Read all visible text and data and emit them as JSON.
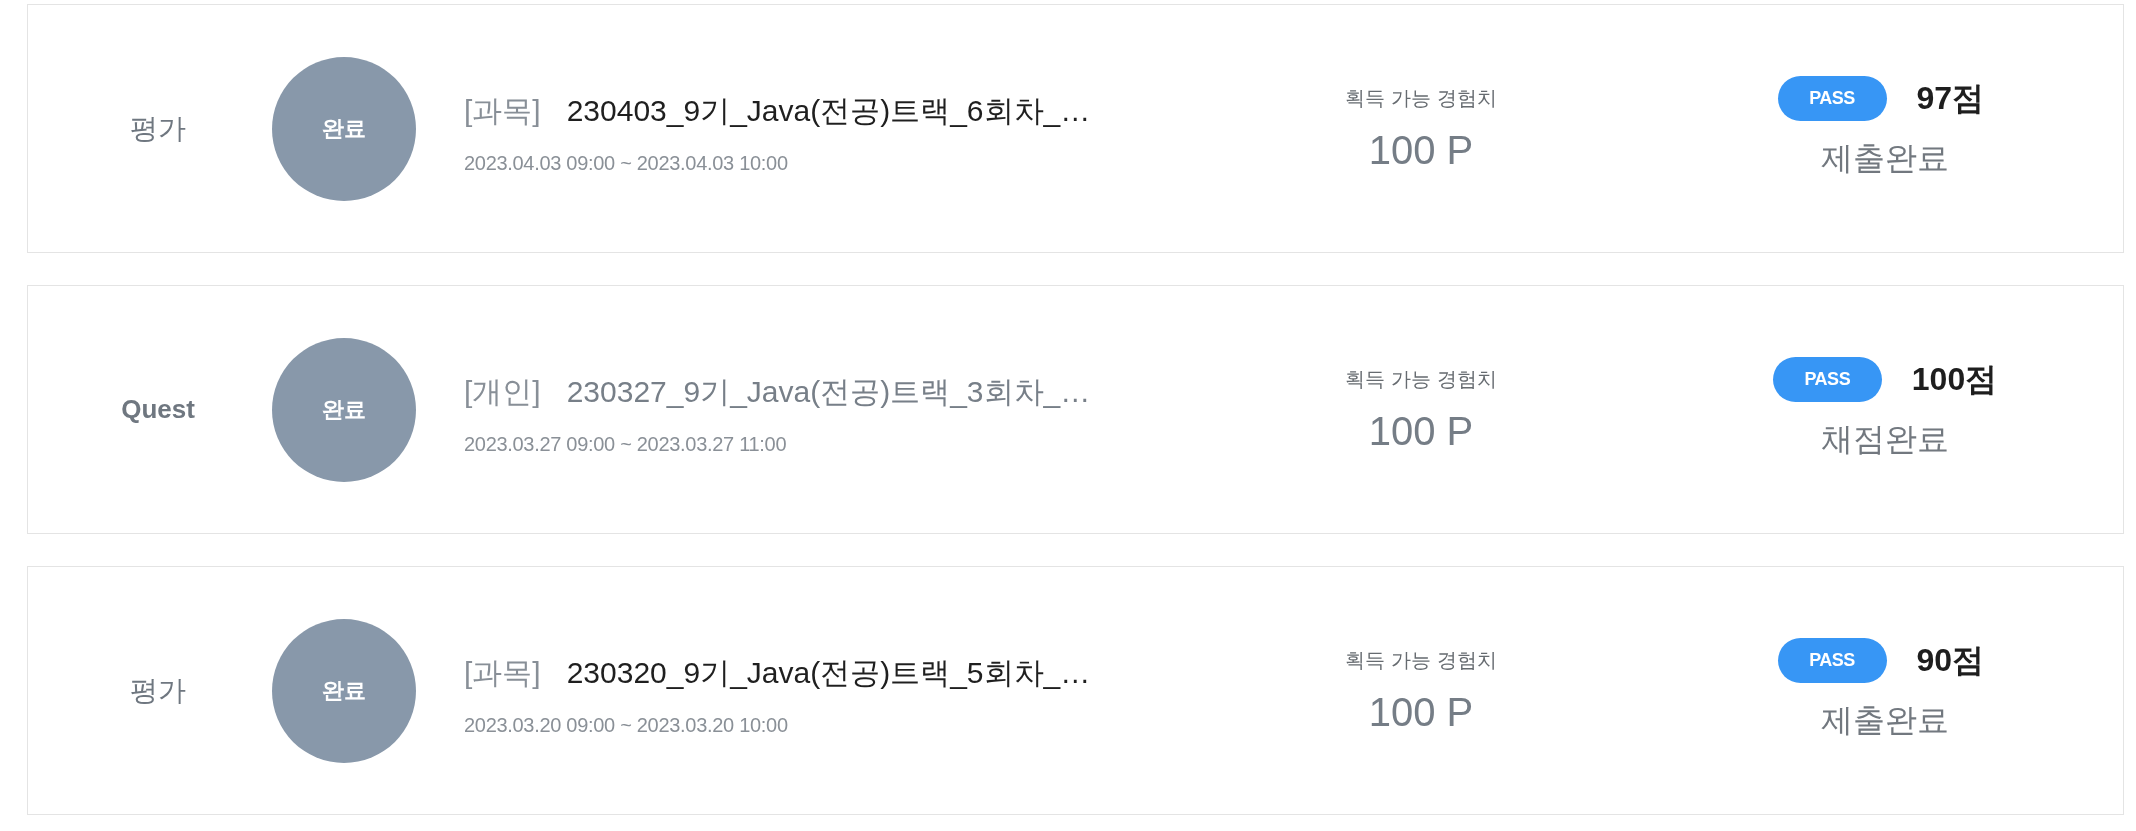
{
  "items": [
    {
      "kind": "evaluation",
      "category": "평가",
      "badge": "완료",
      "tag": "[과목]",
      "title": "230403_9기_Java(전공)트랙_6회차_…",
      "period": "2023.04.03 09:00 ~ 2023.04.03 10:00",
      "exp_label": "획득 가능 경험치",
      "exp_value": "100 P",
      "result": "PASS",
      "score": "97점",
      "status": "제출완료"
    },
    {
      "kind": "quest",
      "category": "Quest",
      "badge": "완료",
      "tag": "[개인]",
      "title": "230327_9기_Java(전공)트랙_3회차_…",
      "period": "2023.03.27 09:00 ~ 2023.03.27 11:00",
      "exp_label": "획득 가능 경험치",
      "exp_value": "100 P",
      "result": "PASS",
      "score": "100점",
      "status": "채점완료"
    },
    {
      "kind": "evaluation",
      "category": "평가",
      "badge": "완료",
      "tag": "[과목]",
      "title": "230320_9기_Java(전공)트랙_5회차_…",
      "period": "2023.03.20 09:00 ~ 2023.03.20 10:00",
      "exp_label": "획득 가능 경험치",
      "exp_value": "100 P",
      "result": "PASS",
      "score": "90점",
      "status": "제출완료"
    }
  ]
}
